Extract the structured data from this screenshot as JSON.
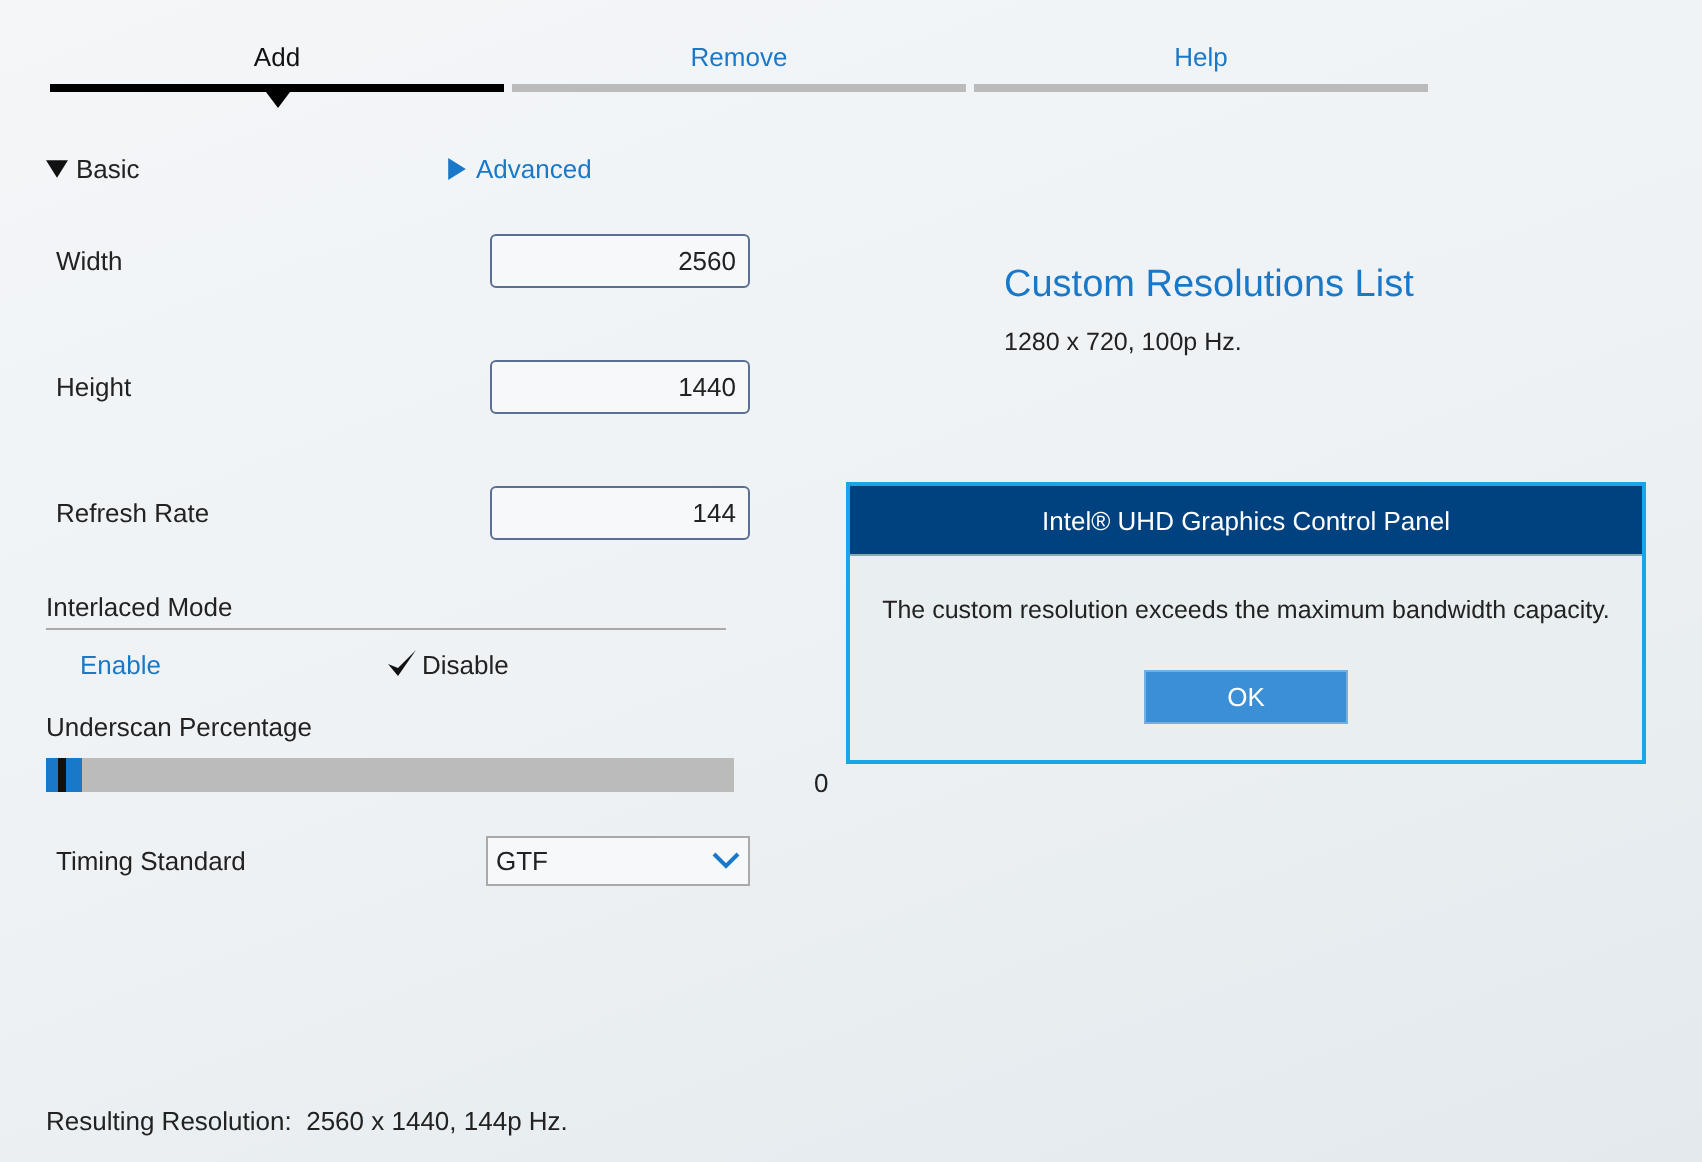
{
  "tabs": [
    {
      "label": "Add",
      "selected": true
    },
    {
      "label": "Remove",
      "selected": false
    },
    {
      "label": "Help",
      "selected": false
    }
  ],
  "sections": [
    {
      "label": "Basic",
      "expanded": true
    },
    {
      "label": "Advanced",
      "expanded": false
    }
  ],
  "fields": [
    {
      "label": "Width",
      "value": "2560"
    },
    {
      "label": "Height",
      "value": "1440"
    },
    {
      "label": "Refresh Rate",
      "value": "144"
    }
  ],
  "interlaced_mode": {
    "title": "Interlaced Mode",
    "options": [
      {
        "label": "Enable",
        "selected": false
      },
      {
        "label": "Disable",
        "selected": true
      }
    ]
  },
  "underscan": {
    "title": "Underscan Percentage",
    "level": 0,
    "reading": "0"
  },
  "timing_standard": {
    "label": "Timing Standard",
    "value": "GTF"
  },
  "resulting_resolution": {
    "label": "Resulting Resolution:",
    "value": "2560 x 1440, 144p Hz."
  },
  "custom_list": {
    "title": "Custom Resolutions List",
    "items": [
      "1280 x 720, 100p Hz."
    ]
  },
  "dialog": {
    "title": "Intel® UHD Graphics Control Panel",
    "message": "The custom resolution exceeds the maximum bandwidth capacity.",
    "button": "OK"
  }
}
